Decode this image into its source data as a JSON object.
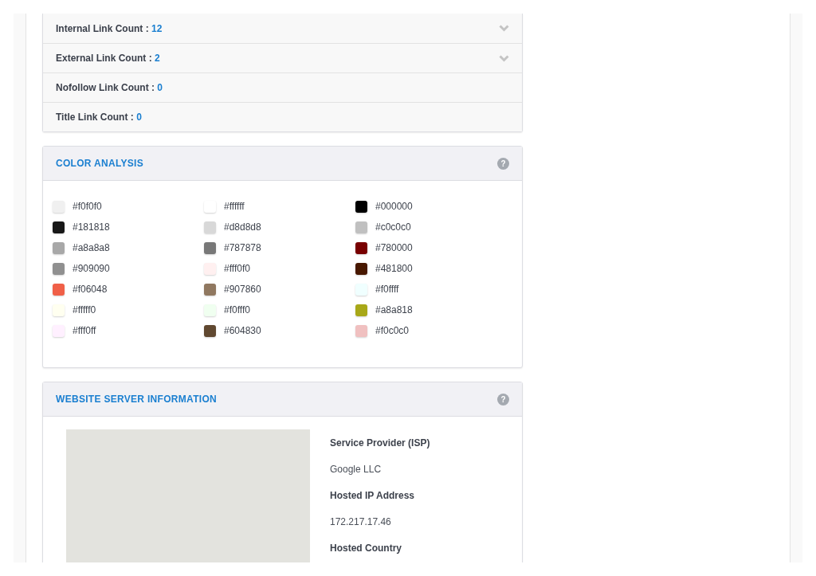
{
  "link_counts": [
    {
      "label": "Internal Link Count :",
      "value": "12",
      "kind": "expandable"
    },
    {
      "label": "External Link Count :",
      "value": "2",
      "kind": "expandable"
    },
    {
      "label": "Nofollow Link Count :",
      "value": "0",
      "kind": "plain"
    },
    {
      "label": "Title Link Count :",
      "value": "0",
      "kind": "plain"
    }
  ],
  "color_analysis": {
    "title": "COLOR ANALYSIS",
    "help": "?",
    "colors": [
      {
        "label": "#f0f0f0",
        "color": "#f0f0f0"
      },
      {
        "label": "#ffffff",
        "color": "#ffffff"
      },
      {
        "label": "#000000",
        "color": "#000000"
      },
      {
        "label": "#181818",
        "color": "#181818"
      },
      {
        "label": "#d8d8d8",
        "color": "#d8d8d8"
      },
      {
        "label": "#c0c0c0",
        "color": "#c0c0c0"
      },
      {
        "label": "#a8a8a8",
        "color": "#a8a8a8"
      },
      {
        "label": "#787878",
        "color": "#787878"
      },
      {
        "label": "#780000",
        "color": "#780000"
      },
      {
        "label": "#909090",
        "color": "#909090"
      },
      {
        "label": "#fff0f0",
        "color": "#fff0f0"
      },
      {
        "label": "#481800",
        "color": "#481800"
      },
      {
        "label": "#f06048",
        "color": "#f06048"
      },
      {
        "label": "#907860",
        "color": "#907860"
      },
      {
        "label": "#f0ffff",
        "color": "#f0ffff"
      },
      {
        "label": "#fffff0",
        "color": "#fffff0"
      },
      {
        "label": "#f0fff0",
        "color": "#f0fff0"
      },
      {
        "label": "#a8a818",
        "color": "#a8a818"
      },
      {
        "label": "#fff0ff",
        "color": "#fff0ff"
      },
      {
        "label": "#604830",
        "color": "#604830"
      },
      {
        "label": "#f0c0c0",
        "color": "#f0c0c0"
      }
    ]
  },
  "server_info": {
    "title": "WEBSITE SERVER INFORMATION",
    "help": "?",
    "fields": [
      {
        "label": "Service Provider (ISP)",
        "value": "Google LLC"
      },
      {
        "label": "Hosted IP Address",
        "value": "172.217.17.46"
      },
      {
        "label": "Hosted Country"
      }
    ]
  }
}
